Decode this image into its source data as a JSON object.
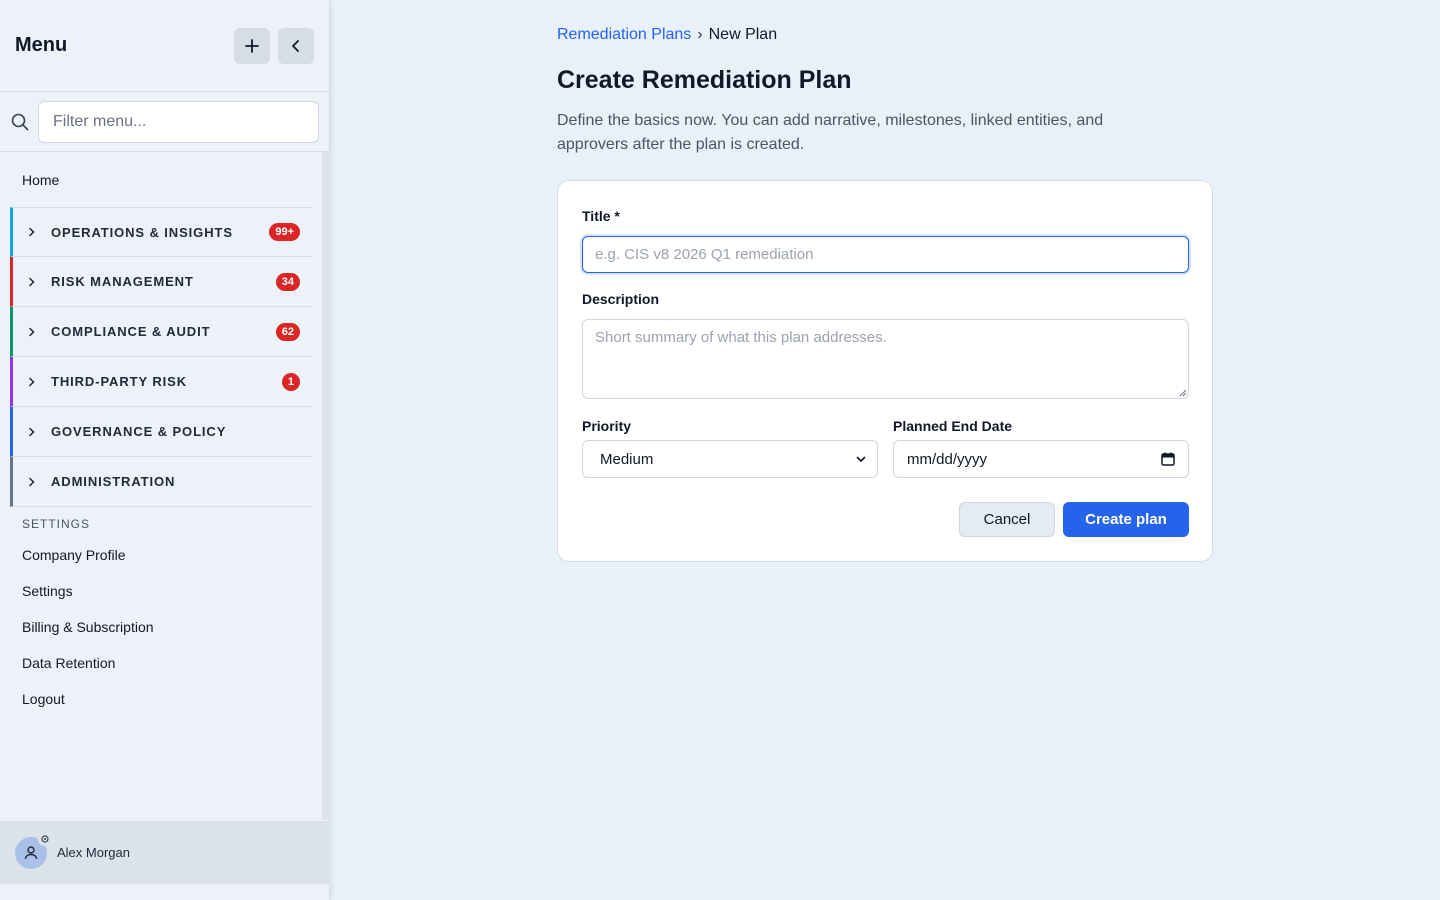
{
  "sidebar": {
    "title": "Menu",
    "add_icon": "plus-icon",
    "collapse_icon": "chevron-left-icon",
    "filter": {
      "placeholder": "Filter menu...",
      "value": ""
    },
    "home": "Home",
    "sections": [
      {
        "label": "OPERATIONS & INSIGHTS",
        "badge": "99+",
        "color": "#0ea5e9"
      },
      {
        "label": "RISK MANAGEMENT",
        "badge": "34",
        "color": "#dc2626"
      },
      {
        "label": "COMPLIANCE & AUDIT",
        "badge": "62",
        "color": "#059669"
      },
      {
        "label": "THIRD-PARTY RISK",
        "badge": "1",
        "color": "#9333ea"
      },
      {
        "label": "GOVERNANCE & POLICY",
        "badge": "",
        "color": "#2563eb"
      },
      {
        "label": "ADMINISTRATION",
        "badge": "",
        "color": "#64748b"
      }
    ],
    "settings_heading": "SETTINGS",
    "settings_items": [
      "Company Profile",
      "Settings",
      "Billing & Subscription",
      "Data Retention",
      "Logout"
    ],
    "user": {
      "name": "Alex Morgan"
    }
  },
  "main": {
    "breadcrumb": {
      "parent": "Remediation Plans",
      "separator": "›",
      "current": "New Plan"
    },
    "title": "Create Remediation Plan",
    "description": "Define the basics now. You can add narrative, milestones, linked entities, and approvers after the plan is created.",
    "form": {
      "title_label": "Title *",
      "title_placeholder": "e.g. CIS v8 2026 Q1 remediation",
      "description_label": "Description",
      "description_placeholder": "Short summary of what this plan addresses.",
      "priority_label": "Priority",
      "priority_value": "Medium",
      "end_date_label": "Planned End Date",
      "end_date_value": "mm/dd/yyyy",
      "cancel_label": "Cancel",
      "create_label": "Create plan"
    }
  },
  "colors": {
    "accent": "#2563eb",
    "badge": "#dc2626",
    "background": "#e8f0f9"
  }
}
